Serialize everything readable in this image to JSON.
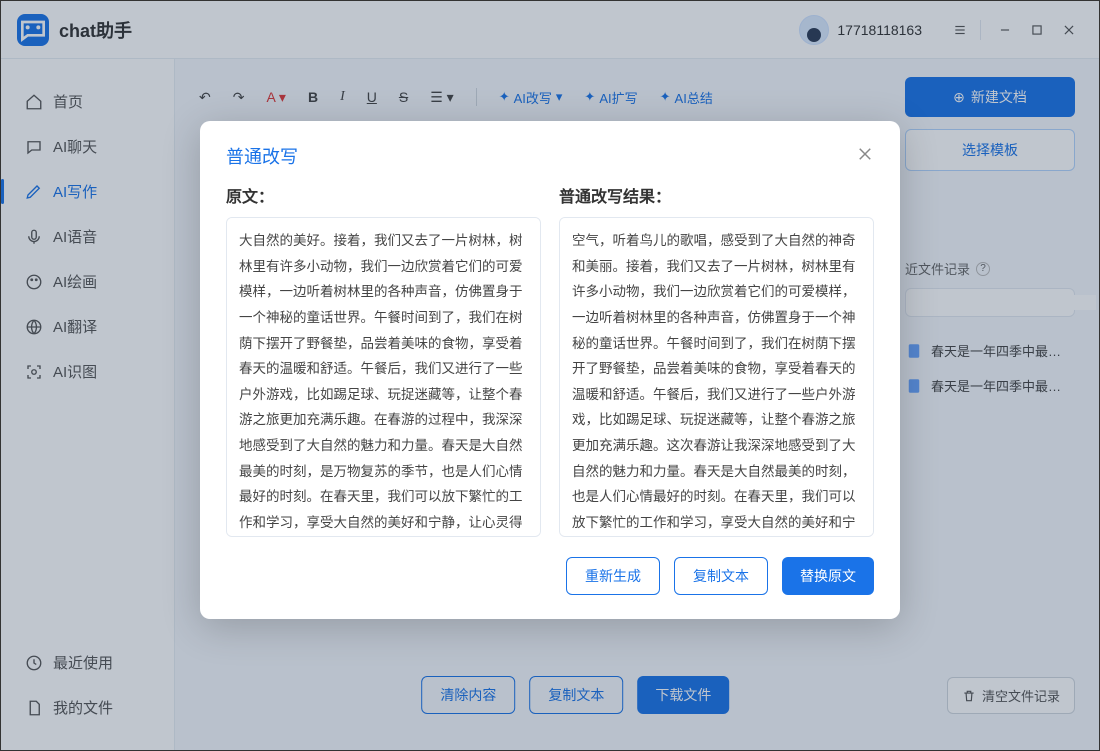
{
  "app": {
    "title": "chat助手"
  },
  "user": {
    "id": "17718118163"
  },
  "sidebar": {
    "items": [
      {
        "label": "首页",
        "name": "home"
      },
      {
        "label": "AI聊天",
        "name": "ai-chat"
      },
      {
        "label": "AI写作",
        "name": "ai-writing",
        "active": true
      },
      {
        "label": "AI语音",
        "name": "ai-voice"
      },
      {
        "label": "AI绘画",
        "name": "ai-draw"
      },
      {
        "label": "AI翻译",
        "name": "ai-translate"
      },
      {
        "label": "AI识图",
        "name": "ai-ocr"
      }
    ],
    "bottom": [
      {
        "label": "最近使用",
        "name": "recent"
      },
      {
        "label": "我的文件",
        "name": "my-files"
      }
    ]
  },
  "toolbar": {
    "ai_rewrite": "AI改写",
    "ai_expand": "AI扩写",
    "ai_summary": "AI总结"
  },
  "topright": {
    "new_doc": "新建文档",
    "choose_template": "选择模板"
  },
  "rightpanel": {
    "header": "近文件记录",
    "search_placeholder": "",
    "items": [
      {
        "label": "春天是一年四季中最…"
      },
      {
        "label": "春天是一年四季中最…"
      }
    ]
  },
  "bottom": {
    "clear": "清除内容",
    "copy": "复制文本",
    "download": "下载文件",
    "clear_files": "清空文件记录"
  },
  "modal": {
    "title": "普通改写",
    "left_label": "原文：",
    "right_label": "普通改写结果：",
    "left_text": "大自然的美好。接着，我们又去了一片树林，树林里有许多小动物，我们一边欣赏着它们的可爱模样，一边听着树林里的各种声音，仿佛置身于一个神秘的童话世界。午餐时间到了，我们在树荫下摆开了野餐垫，品尝着美味的食物，享受着春天的温暖和舒适。午餐后，我们又进行了一些户外游戏，比如踢足球、玩捉迷藏等，让整个春游之旅更加充满乐趣。在春游的过程中，我深深地感受到了大自然的魅力和力量。春天是大自然最美的时刻，是万物复苏的季节，也是人们心情最好的时刻。在春天里，我们可以放下繁忙的工作和学习，享受大自然的美好和宁静，让心灵得到放松和滋养。回顾这次春游，我深深地感受到了春天的美丽和活力，也更加珍惜和家人共度的美好时光。我相信，在未来的日子里，我还会继续探索大自然的奥秘，感受生命的美好。",
    "right_text": "空气，听着鸟儿的歌唱，感受到了大自然的神奇和美丽。接着，我们又去了一片树林，树林里有许多小动物，我们一边欣赏着它们的可爱模样，一边听着树林里的各种声音，仿佛置身于一个神秘的童话世界。午餐时间到了，我们在树荫下摆开了野餐垫，品尝着美味的食物，享受着春天的温暖和舒适。午餐后，我们又进行了一些户外游戏，比如踢足球、玩捉迷藏等，让整个春游之旅更加充满乐趣。这次春游让我深深地感受到了大自然的魅力和力量。春天是大自然最美的时刻，也是人们心情最好的时刻。在春天里，我们可以放下繁忙的工作和学习，享受大自然的美好和宁静。回顾这次春游的经历，我更加珍惜和家人共度的美好时光。我相信在未来的日子里，我还会继续探索大自然的奥秘，感受生命的美好。这个春天让我更加热爱生活，热爱大自然。",
    "regen": "重新生成",
    "copy": "复制文本",
    "replace": "替换原文"
  }
}
